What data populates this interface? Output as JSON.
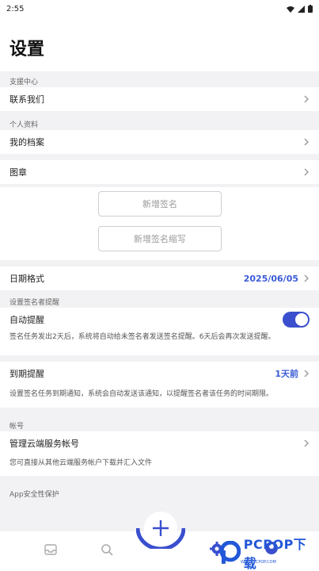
{
  "status": {
    "time": "2:55"
  },
  "header": {
    "title": "设置"
  },
  "support": {
    "section_label": "支援中心",
    "contact_label": "联系我们"
  },
  "profile": {
    "section_label": "个人资料",
    "my_profile_label": "我的档案"
  },
  "seal": {
    "label": "图章",
    "add_signature": "新增签名",
    "add_initials": "新增签名缩写"
  },
  "date_format": {
    "label": "日期格式",
    "value": "2025/06/05"
  },
  "signer_reminder": {
    "section_label": "设置签名者提醒",
    "auto_label": "自动提醒",
    "auto_enabled": true,
    "auto_desc": "签名任务发出2天后，系统将自动给未签名者发送签名提醒。6天后会再次发送提醒。"
  },
  "expiry": {
    "label": "到期提醒",
    "value": "1天前",
    "desc": "设置签名任务到期通知，系统会自动发送该通知，以提醒签名者该任务的时间期限。"
  },
  "account": {
    "section_label": "帐号",
    "manage_label": "管理云端服务帐号",
    "manage_desc": "您可直接从其他云端服务帐户下载并汇入文件"
  },
  "app_security": {
    "section_label": "App安全性保护"
  },
  "tabbar": {
    "icons": [
      "inbox-icon",
      "search-icon",
      "add-icon",
      "settings-icon",
      "profile-icon"
    ]
  },
  "watermark": {
    "brand": "PCPOP下载",
    "tagline": "WWW.PCPOP.COM"
  },
  "colors": {
    "accent": "#3a4fce",
    "link": "#3a5bd6",
    "background": "#f2f2f4"
  }
}
